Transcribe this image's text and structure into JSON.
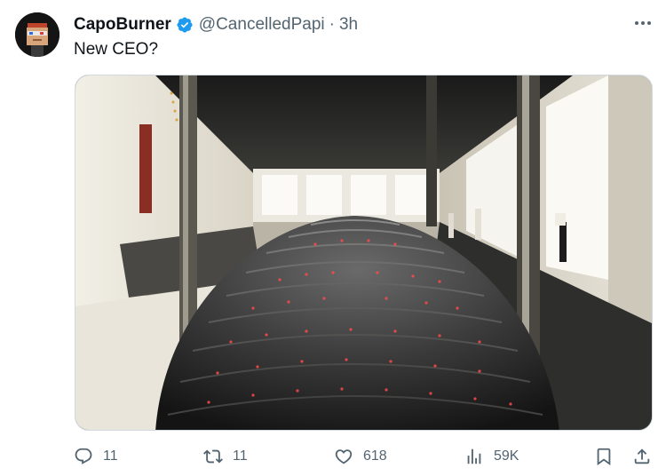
{
  "tweet": {
    "author": {
      "display_name": "CapoBurner",
      "handle": "@CancelledPapi",
      "separator": "·",
      "time": "3h",
      "verified": true,
      "verified_color": "#1d9bf0"
    },
    "text": "New CEO?",
    "media": {
      "type": "photo",
      "accent_light_color": "#ff4a4a"
    },
    "actions": {
      "reply_count": "11",
      "retweet_count": "11",
      "like_count": "618",
      "view_count": "59K"
    },
    "icons": {
      "reply": "reply-icon",
      "retweet": "retweet-icon",
      "like": "heart-icon",
      "views": "views-icon",
      "bookmark": "bookmark-icon",
      "share": "share-icon",
      "more": "more-icon"
    },
    "colors": {
      "text": "#0f1419",
      "secondary": "#536471"
    }
  }
}
